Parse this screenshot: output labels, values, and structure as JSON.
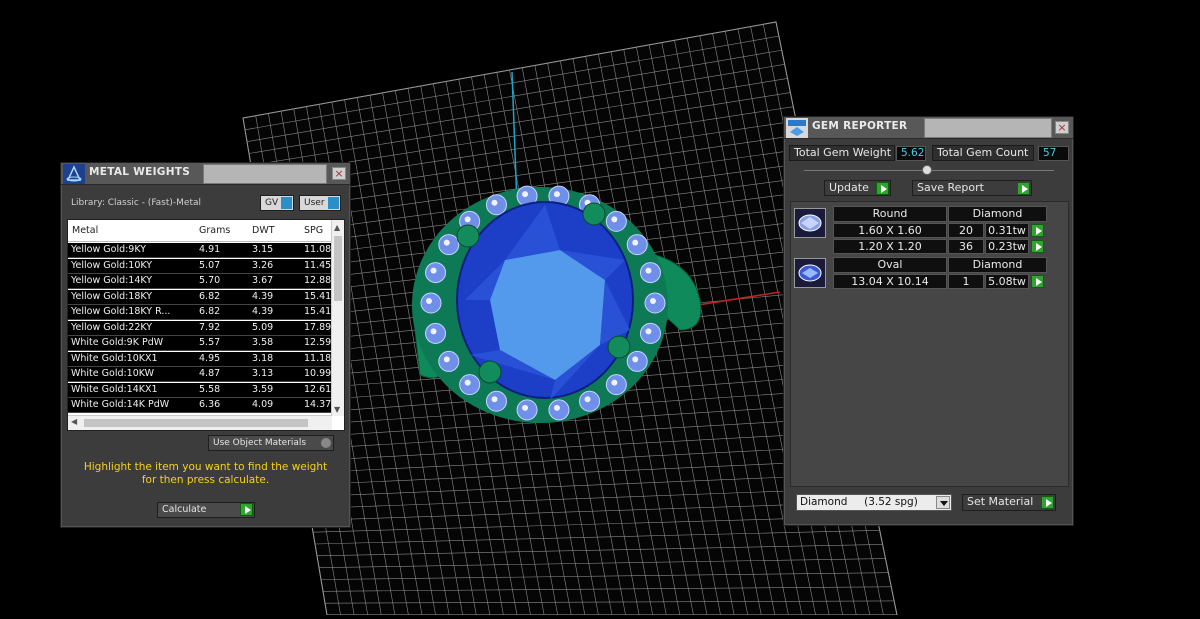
{
  "metal_weights": {
    "title": "METAL WEIGHTS",
    "library_label": "Library: Classic - (Fast)-Metal",
    "gv_label": "GV",
    "user_label": "User",
    "columns": [
      "Metal",
      "Grams",
      "DWT",
      "SPG"
    ],
    "rows": [
      {
        "metal": "Yellow Gold:9KY",
        "grams": "4.91",
        "dwt": "3.15",
        "spg": "11.08"
      },
      {
        "metal": "Yellow Gold:10KY",
        "grams": "5.07",
        "dwt": "3.26",
        "spg": "11.45"
      },
      {
        "metal": "Yellow Gold:14KY",
        "grams": "5.70",
        "dwt": "3.67",
        "spg": "12.88"
      },
      {
        "metal": "Yellow Gold:18KY",
        "grams": "6.82",
        "dwt": "4.39",
        "spg": "15.41"
      },
      {
        "metal": "Yellow Gold:18KY R...",
        "grams": "6.82",
        "dwt": "4.39",
        "spg": "15.41"
      },
      {
        "metal": "Yellow Gold:22KY",
        "grams": "7.92",
        "dwt": "5.09",
        "spg": "17.89"
      },
      {
        "metal": "White Gold:9K PdW",
        "grams": "5.57",
        "dwt": "3.58",
        "spg": "12.59"
      },
      {
        "metal": "White Gold:10KX1",
        "grams": "4.95",
        "dwt": "3.18",
        "spg": "11.18"
      },
      {
        "metal": "White Gold:10KW",
        "grams": "4.87",
        "dwt": "3.13",
        "spg": "10.99"
      },
      {
        "metal": "White Gold:14KX1",
        "grams": "5.58",
        "dwt": "3.59",
        "spg": "12.61"
      },
      {
        "metal": "White Gold:14K PdW",
        "grams": "6.36",
        "dwt": "4.09",
        "spg": "14.37"
      }
    ],
    "use_object_materials": "Use Object Materials",
    "instruction_line1": "Highlight the item you want to find the weight",
    "instruction_line2": "for then press calculate.",
    "calculate_label": "Calculate"
  },
  "gem_reporter": {
    "title": "GEM REPORTER",
    "total_weight_label": "Total Gem Weight",
    "total_weight_value": "5.62",
    "total_count_label": "Total Gem Count",
    "total_count_value": "57",
    "update_label": "Update",
    "save_report_label": "Save Report",
    "groups": [
      {
        "shape": "Round",
        "material": "Diamond",
        "rows": [
          {
            "size": "1.60 X 1.60",
            "count": "20",
            "weight": "0.31tw"
          },
          {
            "size": "1.20 X 1.20",
            "count": "36",
            "weight": "0.23tw"
          }
        ]
      },
      {
        "shape": "Oval",
        "material": "Diamond",
        "rows": [
          {
            "size": "13.04 X 10.14",
            "count": "1",
            "weight": "5.08tw"
          }
        ]
      }
    ],
    "material_select": "Diamond     (3.52 spg)",
    "set_material_label": "Set Material"
  },
  "colors": {
    "accent_yellow": "#f5d21c",
    "value_cyan": "#49d0e8",
    "action_green": "#2fa52f",
    "sapphire": "#1d3fc8",
    "prong_green": "#0f8a5a"
  }
}
